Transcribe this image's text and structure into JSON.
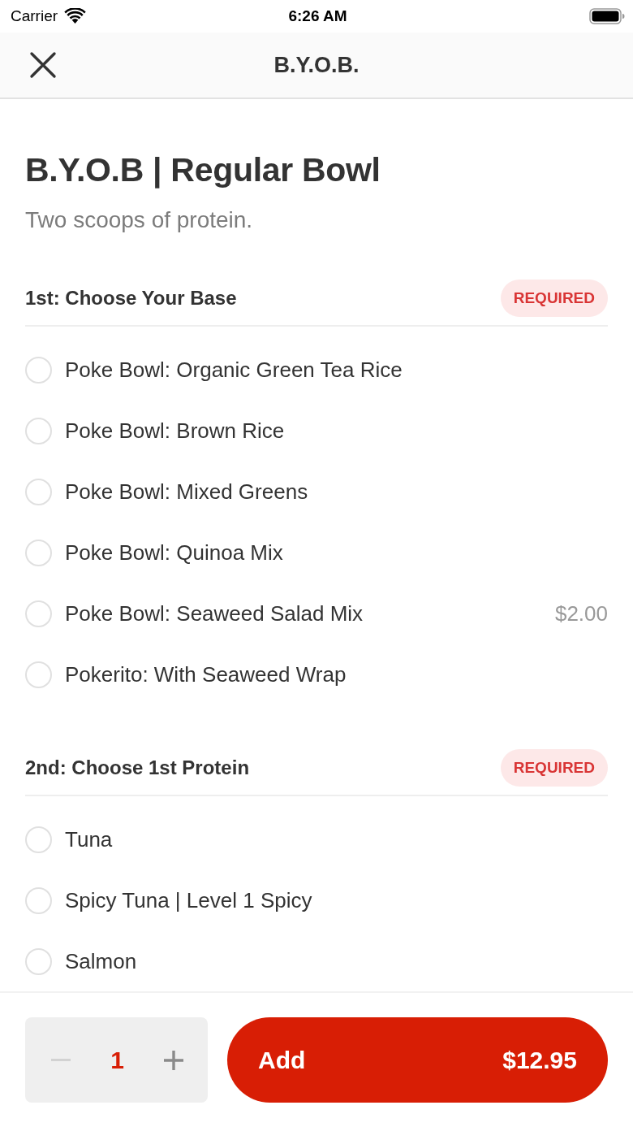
{
  "status_bar": {
    "carrier": "Carrier",
    "time": "6:26 AM"
  },
  "nav_bar": {
    "title": "B.Y.O.B."
  },
  "item": {
    "title": "B.Y.O.B | Regular Bowl",
    "description": "Two scoops of protein."
  },
  "option_groups": [
    {
      "title": "1st: Choose Your Base",
      "badge": "REQUIRED",
      "options": [
        {
          "label": "Poke Bowl: Organic Green Tea Rice",
          "selected": false
        },
        {
          "label": "Poke Bowl: Brown Rice",
          "selected": false
        },
        {
          "label": "Poke Bowl: Mixed Greens",
          "selected": false
        },
        {
          "label": "Poke Bowl: Quinoa Mix",
          "selected": false
        },
        {
          "label": "Poke Bowl: Seaweed Salad Mix",
          "price": "$2.00",
          "selected": false
        },
        {
          "label": "Pokerito: With Seaweed Wrap",
          "selected": false
        }
      ]
    },
    {
      "title": "2nd: Choose 1st Protein",
      "badge": "REQUIRED",
      "options": [
        {
          "label": "Tuna",
          "selected": false
        },
        {
          "label": "Spicy Tuna | Level 1 Spicy",
          "selected": false
        },
        {
          "label": "Salmon",
          "selected": false
        }
      ]
    }
  ],
  "footer": {
    "decrease": {
      "disabled": true
    },
    "quantity": "1",
    "increase": {
      "disabled": false
    },
    "add_label": "Add",
    "total": "$12.95"
  }
}
